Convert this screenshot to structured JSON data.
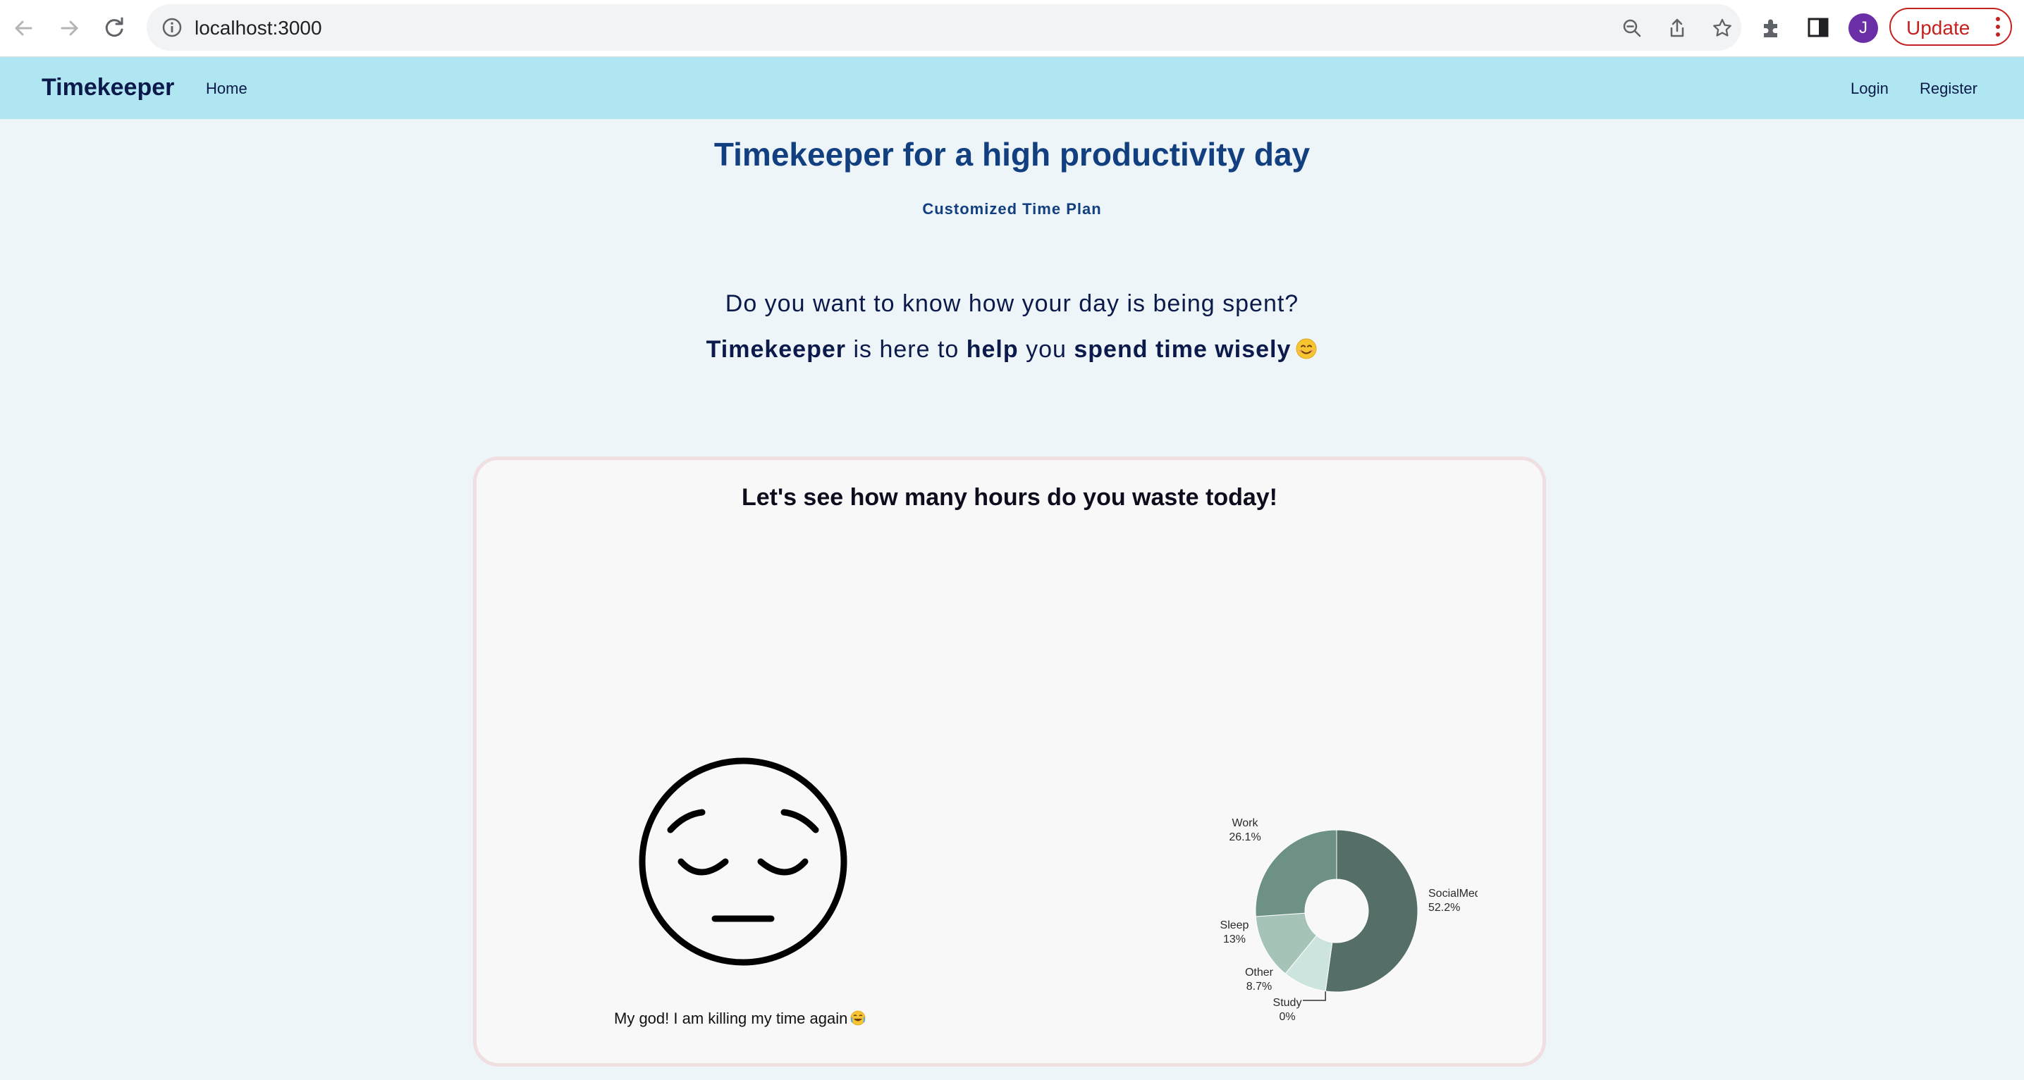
{
  "browser": {
    "url": "localhost:3000",
    "profile_initial": "J",
    "update_label": "Update"
  },
  "navbar": {
    "brand": "Timekeeper",
    "home": "Home",
    "login": "Login",
    "register": "Register"
  },
  "hero": {
    "title": "Timekeeper for a high productivity day",
    "subtitle": "Customized Time Plan",
    "question": "Do you want to know how your day is being spent?",
    "tagline": {
      "brand": "Timekeeper",
      "t1": " is here to ",
      "help": "help",
      "t2": " you ",
      "wisely": "spend time wisely"
    }
  },
  "card": {
    "title": "Let's see how many hours do you waste today!",
    "caption": "My god! I am killing my time again"
  },
  "chart_data": {
    "type": "pie",
    "hole": true,
    "labels": [
      "SocialMedia",
      "Study",
      "Other",
      "Sleep",
      "Work"
    ],
    "values": [
      52.2,
      0,
      8.7,
      13,
      26.1
    ],
    "value_labels": [
      "52.2%",
      "0%",
      "8.7%",
      "13%",
      "26.1%"
    ],
    "colors": [
      "#556e68",
      "#556e68",
      "#cde3dd",
      "#a6c3b7",
      "#6d9184"
    ]
  }
}
